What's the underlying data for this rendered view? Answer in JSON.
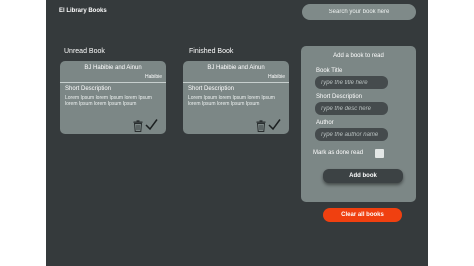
{
  "header": {
    "brand": "El Library Books",
    "search_placeholder": "Search your book here"
  },
  "columns": {
    "unread_title": "Unread Book",
    "finished_title": "Finished Book"
  },
  "unread_card": {
    "authors": "BJ Habibie and Ainun",
    "genre": "Habibie",
    "desc_title": "Short Description",
    "desc": "Lorem Ipsum lorem Ipsum lorem Ipsum lorem Ipsum lorem Ipsum Ipsum"
  },
  "finished_card": {
    "authors": "BJ Habibie and Ainun",
    "genre": "Habibie",
    "desc_title": "Short Description",
    "desc": "Lorem Ipsum lorem Ipsum lorem Ipsum lorem Ipsum lorem Ipsum Ipsum"
  },
  "form": {
    "title": "Add a book to read",
    "book_title_label": "Book Title",
    "book_title_placeholder": "Type the title here",
    "short_desc_label": "Short Description",
    "short_desc_placeholder": "Type the desc here",
    "author_label": "Author",
    "author_placeholder": "Type the author name",
    "done_label": "Mark as done read",
    "done_checked": false,
    "add_button": "Add book"
  },
  "clear_button": "Clear all books",
  "colors": {
    "app_background": "#353a3c",
    "panel": "#7c8786",
    "accent": "#f04010"
  },
  "icons": [
    "trash-icon",
    "check-icon"
  ]
}
